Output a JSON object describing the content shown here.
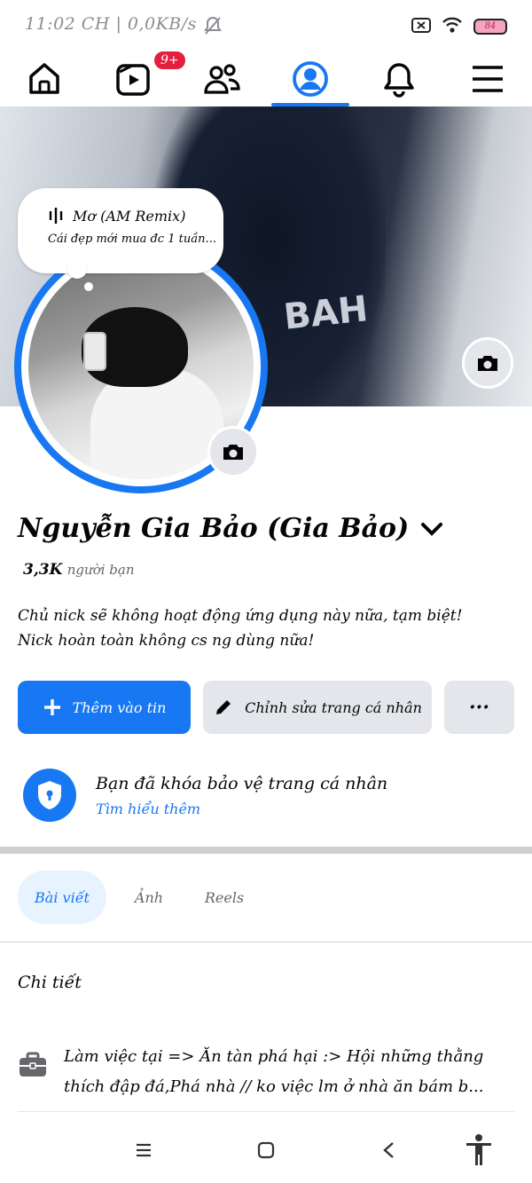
{
  "status_bar": {
    "time_text": "11:02 CH | 0,0KB/s",
    "battery": "84"
  },
  "nav": {
    "badge": "9+",
    "active": "profile",
    "items": [
      "home",
      "video",
      "friends",
      "profile",
      "notifications",
      "menu"
    ]
  },
  "music": {
    "title": "Mơ (AM Remix)",
    "caption": "Cái đẹp mới mua đc 1 tuần..."
  },
  "profile": {
    "name": "Nguyễn Gia Bảo (Gia Bảo)",
    "friends_count": "3,3K",
    "friends_label": "người bạn",
    "bio_line1": "Chủ nick sẽ không hoạt động ứng dụng này nữa, tạm biệt!",
    "bio_line2": "Nick hoàn toàn không cs ng dùng nữa!",
    "cover_text": "BAH"
  },
  "actions": {
    "add_story": "Thêm vào tin",
    "edit_profile": "Chỉnh sửa trang cá nhân",
    "more": "···"
  },
  "lock_notice": {
    "title": "Bạn đã khóa bảo vệ trang cá nhân",
    "link": "Tìm hiểu thêm"
  },
  "tabs": [
    {
      "label": "Bài viết",
      "active": true
    },
    {
      "label": "Ảnh",
      "active": false
    },
    {
      "label": "Reels",
      "active": false
    }
  ],
  "details": {
    "heading": "Chi tiết",
    "work_text": "Làm việc tại => Ăn tàn phá hại :> Hội những thằng thích đập đá,Phá nhà // ko việc lm ở nhà ăn bám b..."
  },
  "colors": {
    "accent": "#1877f2",
    "badge": "#e41e3f",
    "button_gray": "#e4e6eb"
  }
}
